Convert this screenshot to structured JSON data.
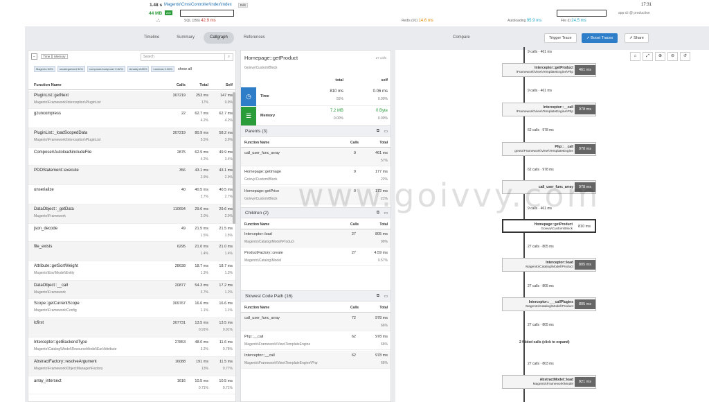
{
  "toolbar": {
    "duration": "1.48 s",
    "route": "Magento\\Cms\\Controller\\Index\\Index",
    "edit": "Edit",
    "memory": "44 MB",
    "status": "200",
    "sql_label": "SQL (356)",
    "sql_time": "42.9 ms",
    "redis_label": "Redis (91)",
    "redis_time": "14.6 ms",
    "autoload_label": "Autoloading",
    "autoload_time": "95.9 ms",
    "file_label": "File (i)",
    "file_time": "24.5 ms",
    "clock": "17:31",
    "env": "app:cli @ production"
  },
  "tabs": [
    "Timeline",
    "Summary",
    "Callgraph"
  ],
  "references": "References",
  "compare": "Compare",
  "buttons": {
    "trigger": "Trigger Trace",
    "boost": "Boost Traces",
    "share": "Share"
  },
  "left": {
    "toggle": [
      "Time",
      "Memory"
    ],
    "search_placeholder": "Search",
    "filters": [
      "Magento 63%",
      "uncategorized 34%",
      "composer/composer 0.82%",
      "Amasty 8.85%",
      "Laminas 0.36%"
    ],
    "show_all": "show all",
    "columns": [
      "Function Name",
      "Calls",
      "Total",
      "Self"
    ],
    "rows": [
      {
        "fn": "PluginList::getNext",
        "ns": "Magento\\Framework\\Interception\\PluginList",
        "calls": "307219",
        "total": "253 ms",
        "tp": "17%",
        "self": "147 ms",
        "sp": "9.9%"
      },
      {
        "fn": "gzuncompress",
        "ns": "",
        "calls": "22",
        "total": "62.7 ms",
        "tp": "4.2%",
        "self": "62.7 ms",
        "sp": "4.2%"
      },
      {
        "fn": "PluginList::_loadScopedData",
        "ns": "Magento\\Framework\\Interception\\PluginList",
        "calls": "307219",
        "total": "80.9 ms",
        "tp": "5.5%",
        "self": "58.2 ms",
        "sp": "3.9%"
      },
      {
        "fn": "Composer\\Autoload\\includeFile",
        "ns": "",
        "calls": "2875",
        "total": "62.9 ms",
        "tp": "4.2%",
        "self": "49.9 ms",
        "sp": "3.4%"
      },
      {
        "fn": "PDOStatement::execute",
        "ns": "",
        "calls": "356",
        "total": "43.1 ms",
        "tp": "2.9%",
        "self": "43.1 ms",
        "sp": "2.9%"
      },
      {
        "fn": "unserialize",
        "ns": "",
        "calls": "40",
        "total": "40.5 ms",
        "tp": "2.7%",
        "self": "40.5 ms",
        "sp": "2.7%"
      },
      {
        "fn": "DataObject::_getData",
        "ns": "Magento\\Framework",
        "calls": "110694",
        "total": "29.6 ms",
        "tp": "2.0%",
        "self": "29.6 ms",
        "sp": "2.0%"
      },
      {
        "fn": "json_decode",
        "ns": "",
        "calls": "49",
        "total": "21.5 ms",
        "tp": "1.5%",
        "self": "21.5 ms",
        "sp": "1.5%"
      },
      {
        "fn": "file_exists",
        "ns": "",
        "calls": "6295",
        "total": "21.0 ms",
        "tp": "1.4%",
        "self": "21.0 ms",
        "sp": "1.4%"
      },
      {
        "fn": "Attribute::getSortWeight",
        "ns": "Magento\\Eav\\Model\\Entity",
        "calls": "28638",
        "total": "18.7 ms",
        "tp": "1.3%",
        "self": "18.7 ms",
        "sp": "1.3%"
      },
      {
        "fn": "DataObject::__call",
        "ns": "Magento\\Framework",
        "calls": "20877",
        "total": "54.3 ms",
        "tp": "3.7%",
        "self": "17.2 ms",
        "sp": "1.2%"
      },
      {
        "fn": "Scope::getCurrentScope",
        "ns": "Magento\\Framework\\Config",
        "calls": "309767",
        "total": "16.6 ms",
        "tp": "1.1%",
        "self": "16.6 ms",
        "sp": "1.1%"
      },
      {
        "fn": "lcfirst",
        "ns": "",
        "calls": "307731",
        "total": "13.5 ms",
        "tp": "0.91%",
        "self": "13.5 ms",
        "sp": "0.91%"
      },
      {
        "fn": "Interceptor::getBackendType",
        "ns": "Magento\\Catalog\\Model\\ResourceModel\\Eav\\Attribute",
        "calls": "27853",
        "total": "48.0 ms",
        "tp": "3.2%",
        "self": "11.6 ms",
        "sp": "0.78%"
      },
      {
        "fn": "AbstractFactory::resolveArgument",
        "ns": "Magento\\Framework\\ObjectManager\\Factory",
        "calls": "16088",
        "total": "191 ms",
        "tp": "13%",
        "self": "11.5 ms",
        "sp": "0.77%"
      },
      {
        "fn": "array_intersect",
        "ns": "",
        "calls": "1616",
        "total": "10.5 ms",
        "tp": "0.71%",
        "self": "10.5 ms",
        "sp": "0.71%"
      }
    ]
  },
  "mid": {
    "title": "Homepage::getProduct",
    "calls": "27 calls",
    "ns": "Goivvy\\Custom\\Block",
    "hdr_total": "total",
    "hdr_self": "self",
    "time": {
      "label": "Time",
      "total": "810 ms",
      "tp": "55%",
      "self": "0.06 ms",
      "sp": "0.00%"
    },
    "memory": {
      "label": "Memory",
      "total": "7.2 MB",
      "tp": "0.00%",
      "self": "0 Byte",
      "sp": "0.00%"
    },
    "parents_title": "Parents (3)",
    "children_title": "Children (2)",
    "slowest_title": "Slowest Code Path (16)",
    "col_fn": "Function Name",
    "col_calls": "Calls",
    "col_total": "Total",
    "parents": [
      {
        "fn": "call_user_func_array",
        "ns": "",
        "calls": "9",
        "total": "461 ms",
        "pct": "57%"
      },
      {
        "fn": "Homepage::getImage",
        "ns": "Goivvy\\Custom\\Block",
        "calls": "9",
        "total": "177 ms",
        "pct": "22%"
      },
      {
        "fn": "Homepage::getPrice",
        "ns": "Goivvy\\Custom\\Block",
        "calls": "9",
        "total": "172 ms",
        "pct": "21%"
      }
    ],
    "children": [
      {
        "fn": "Interceptor::load",
        "ns": "Magento\\Catalog\\Model\\Product",
        "calls": "27",
        "total": "805 ms",
        "pct": "99%"
      },
      {
        "fn": "ProductFactory::create",
        "ns": "Magento\\Catalog\\Model",
        "calls": "27",
        "total": "4.59 ms",
        "pct": "0.57%"
      }
    ],
    "slowest": [
      {
        "fn": "call_user_func_array",
        "ns": "",
        "calls": "72",
        "total": "978 ms",
        "pct": "66%"
      },
      {
        "fn": "Php::__call",
        "ns": "Magento\\Framework\\View\\TemplateEngine",
        "calls": "62",
        "total": "978 ms",
        "pct": "66%"
      },
      {
        "fn": "Interceptor::__call",
        "ns": "Magento\\Framework\\View\\TemplateEngine\\Php",
        "calls": "62",
        "total": "978 ms",
        "pct": "66%"
      }
    ]
  },
  "graph": {
    "nodes": [
      {
        "t": "Interceptor::getProduct",
        "n": "\\Framework\\View\\TemplateEngine\\Php",
        "m": "461 ms"
      },
      {
        "t": "Interceptor::__call",
        "n": "\\Framework\\View\\TemplateEngine\\Php",
        "m": "978 ms"
      },
      {
        "t": "Php::__call",
        "n": "gento\\Framework\\View\\TemplateEngine",
        "m": "978 ms"
      },
      {
        "t": "call_user_func_array",
        "n": "",
        "m": "978 ms"
      },
      {
        "t": "Homepage::getProduct",
        "n": "Goivvy\\Custom\\Block",
        "m": "810 ms"
      },
      {
        "t": "Interceptor::load",
        "n": "Magento\\Catalog\\Model\\Product",
        "m": "805 ms"
      },
      {
        "t": "Interceptor::___callPlugins",
        "n": "Magento\\Catalog\\Model\\Product",
        "m": "805 ms"
      },
      {
        "t": "AbstractModel::load",
        "n": "Magento\\Framework\\Model",
        "m": "821 ms"
      }
    ],
    "edges": [
      "9 calls · 461 ms",
      "9 calls · 461 ms",
      "62 calls · 978 ms",
      "62 calls · 978 ms",
      "9 calls · 461 ms",
      "27 calls · 805 ms",
      "27 calls · 805 ms",
      "27 calls · 805 ms",
      "27 calls · 803 ms"
    ],
    "folded": "2 folded calls (click to expand)"
  },
  "watermark": "www.goivvy.com"
}
